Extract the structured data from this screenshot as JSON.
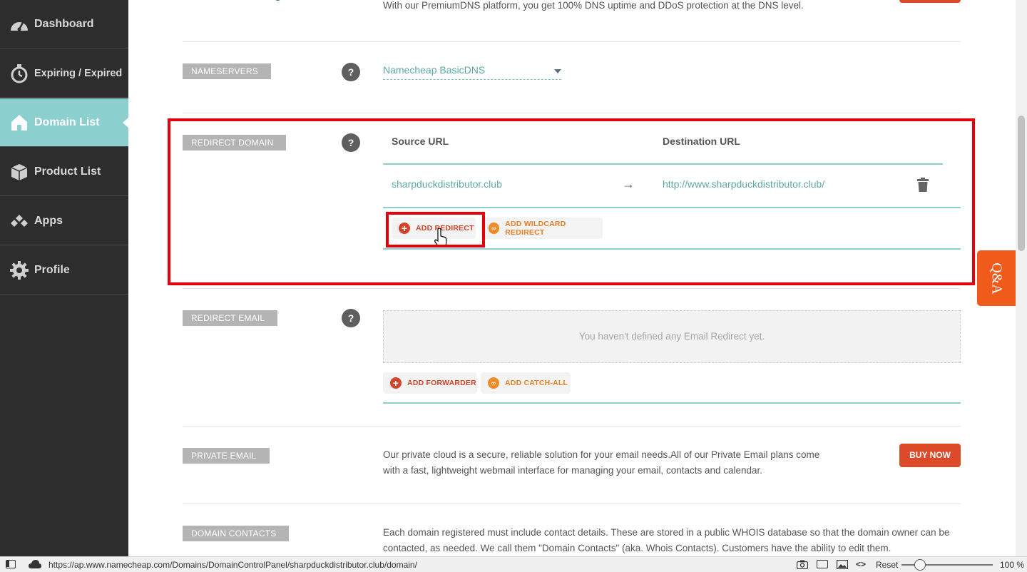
{
  "sidebar": {
    "items": [
      {
        "label": "Dashboard",
        "icon": "speedometer-icon"
      },
      {
        "label": "Expiring / Expired",
        "icon": "stopwatch-icon"
      },
      {
        "label": "Domain List",
        "icon": "home-icon",
        "active": true
      },
      {
        "label": "Product List",
        "icon": "box-icon"
      },
      {
        "label": "Apps",
        "icon": "apps-icon"
      },
      {
        "label": "Profile",
        "icon": "gear-icon"
      }
    ]
  },
  "premium_dns": {
    "description": "With our PremiumDNS platform, you get 100% DNS uptime and DDoS protection at the DNS level."
  },
  "nameservers": {
    "tag": "NAMESERVERS",
    "help": "?",
    "selected": "Namecheap BasicDNS"
  },
  "redirect_domain": {
    "tag": "REDIRECT DOMAIN",
    "help": "?",
    "source_header": "Source URL",
    "destination_header": "Destination URL",
    "rows": [
      {
        "source": "sharpduckdistributor.club",
        "arrow": "→",
        "destination": "http://www.sharpduckdistributor.club/"
      }
    ],
    "add_redirect": "ADD REDIRECT",
    "add_wildcard": "ADD WILDCARD REDIRECT"
  },
  "redirect_email": {
    "tag": "REDIRECT EMAIL",
    "help": "?",
    "empty_message": "You haven't defined any Email Redirect yet.",
    "add_forwarder": "ADD FORWARDER",
    "add_catch_all": "ADD CATCH-ALL"
  },
  "private_email": {
    "tag": "PRIVATE EMAIL",
    "description": "Our private cloud is a secure, reliable solution for your email needs.All of our Private Email plans come with a fast, lightweight webmail interface for managing your email, contacts and calendar.",
    "button": "BUY NOW"
  },
  "domain_contacts": {
    "tag": "DOMAIN CONTACTS",
    "description": "Each domain registered must include contact details. These are stored in a public WHOIS database so that the domain owner can be contacted, as needed. We call them \"Domain Contacts\" (aka. Whois Contacts). Customers have the ability to edit them."
  },
  "qa_tab": {
    "label": "Q&A"
  },
  "colors": {
    "accent": "#8ccfcf",
    "brand_red": "#dc4a2a",
    "highlight": "#e4000b",
    "qa_orange": "#f05a1a"
  },
  "statusbar": {
    "url": "https://ap.www.namecheap.com/Domains/DomainControlPanel/sharpduckdistributor.club/domain/",
    "reset": "Reset",
    "zoom": "100 %"
  }
}
